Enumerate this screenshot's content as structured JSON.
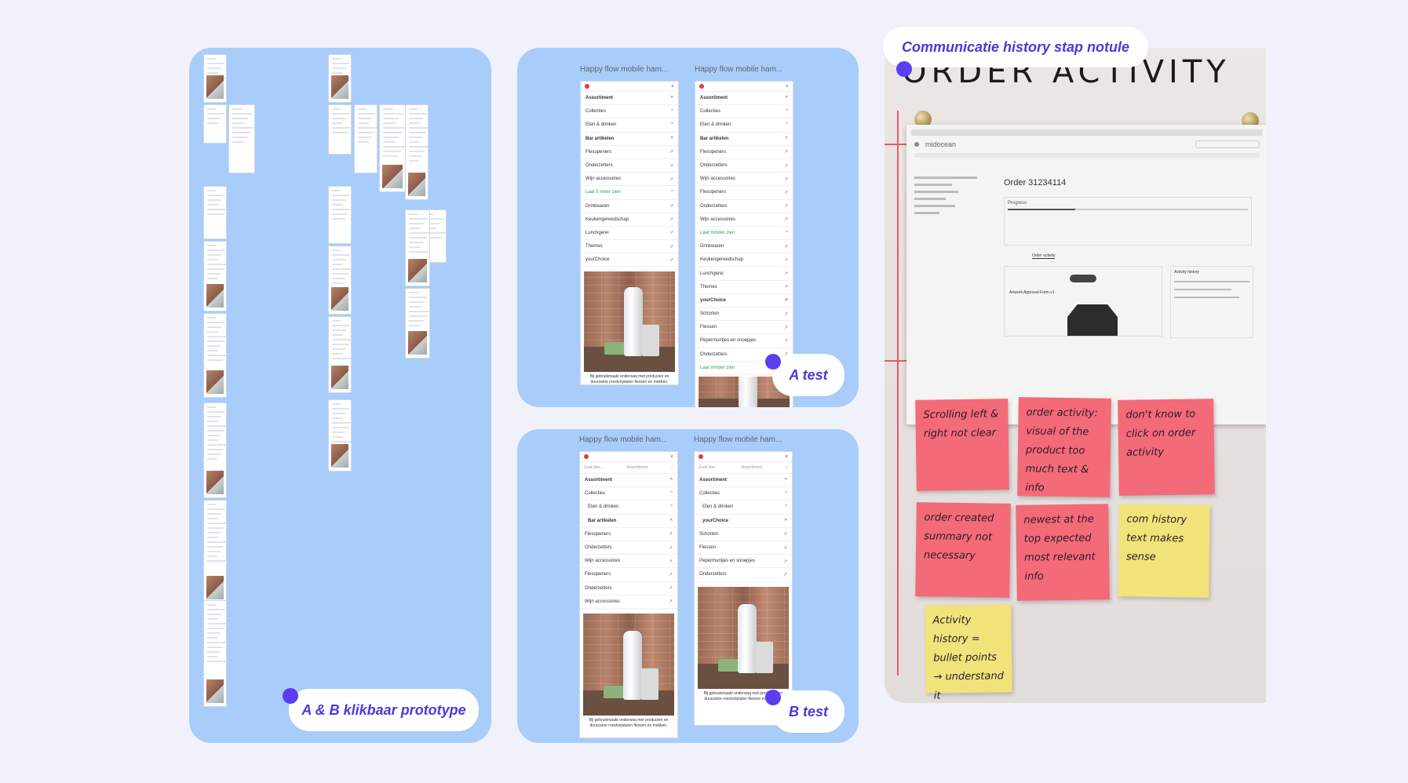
{
  "panels": {
    "prototype": {
      "label": "A & B klikbaar prototype"
    },
    "a_test": {
      "label": "A test",
      "phone_titles": [
        "Happy flow mobile ham...",
        "Happy flow mobile ham..."
      ]
    },
    "b_test": {
      "label": "B test",
      "phone_titles": [
        "Happy flow mobile ham...",
        "Happy flow mobile ham..."
      ]
    },
    "photo": {
      "label": "Communicatie history stap notule",
      "heading": "ORDER ACTIVITY"
    }
  },
  "phones": {
    "a1": {
      "rows": [
        "Assortiment",
        "Collecties",
        "Eten & drinken",
        "Bar artikelen",
        "Flesopeners",
        "Onderzetters",
        "Wijn accessoires",
        "Laat 5 meer zien",
        "Drinkwaren",
        "Keukengereedschap",
        "Lunchgerei",
        "Themes",
        "yourChoice"
      ],
      "caption": "Bij gebruikmaakt onderwaq met producten en duurzame roestvrijstalen flessen en mokken."
    },
    "a2": {
      "rows": [
        "Assortiment",
        "Collecties",
        "Eten & drinken",
        "Bar artikelen",
        "Flesopeners",
        "Onderzetters",
        "Wijn accessoires",
        "Flesopeners",
        "Onderzetters",
        "Wijn accessoires",
        "Laat minder zien",
        "Drinkwaren",
        "Keukengereedschap",
        "Lunchgerei",
        "Themes",
        "yourChoice",
        "Schorten",
        "Flessen",
        "Pepermuntjes en snoepjes",
        "Onderzetters",
        "Laat minder zien"
      ]
    },
    "b1": {
      "search_placeholder": "Zoek hier...",
      "search_scope": "Assortiment",
      "rows": [
        "Assortiment",
        "Collecties",
        "Eten & drinken",
        "Bar artikelen",
        "Flesopeners",
        "Onderzetters",
        "Wijn accessoires",
        "Flesopeners",
        "Onderzetters",
        "Wijn accessoires"
      ],
      "caption": "Bij gebruikmaakt onderwaq met producten en duurzame roestvrijstalen flessen en mokken."
    },
    "b2": {
      "search_placeholder": "Zoek hier...",
      "search_scope": "Assortiment",
      "rows": [
        "Assortiment",
        "Collecties",
        "Eten & drinken",
        "yourChoice",
        "Schorten",
        "Flessen",
        "Pepermuntjes en snoepjes",
        "Onderzetters"
      ],
      "caption": "Bij gebruikmaakt onderwaq met producten en duurzame roestvrijstalen flessen en mokken."
    }
  },
  "sheet": {
    "brand": "midocean",
    "order_title": "Order 31234114",
    "progress_label": "Progress",
    "tab": "Order activity",
    "activity_title": "Activity history",
    "file": "Artwork Approval Form v1"
  },
  "stickies": [
    {
      "color": "pink",
      "text": "Scrolling left & right not clear"
    },
    {
      "color": "pink",
      "text": "order activity: visual of the product too much text & info"
    },
    {
      "color": "pink",
      "text": "don't know to click on order activity"
    },
    {
      "color": "pink",
      "text": "order created summary not necessary"
    },
    {
      "color": "pink",
      "text": "newest at the top expected most relevant info"
    },
    {
      "color": "yellow",
      "text": "com history text makes sense"
    },
    {
      "color": "yellow",
      "text": "Activity history = bullet points → understand it"
    }
  ],
  "colors": {
    "background": "#f0f1fa",
    "panel": "#a9cdfb",
    "accent": "#5b3ef0",
    "label_text": "#4a3ad8",
    "sticky_pink": "#f36a79",
    "sticky_yellow": "#f2e27a"
  }
}
